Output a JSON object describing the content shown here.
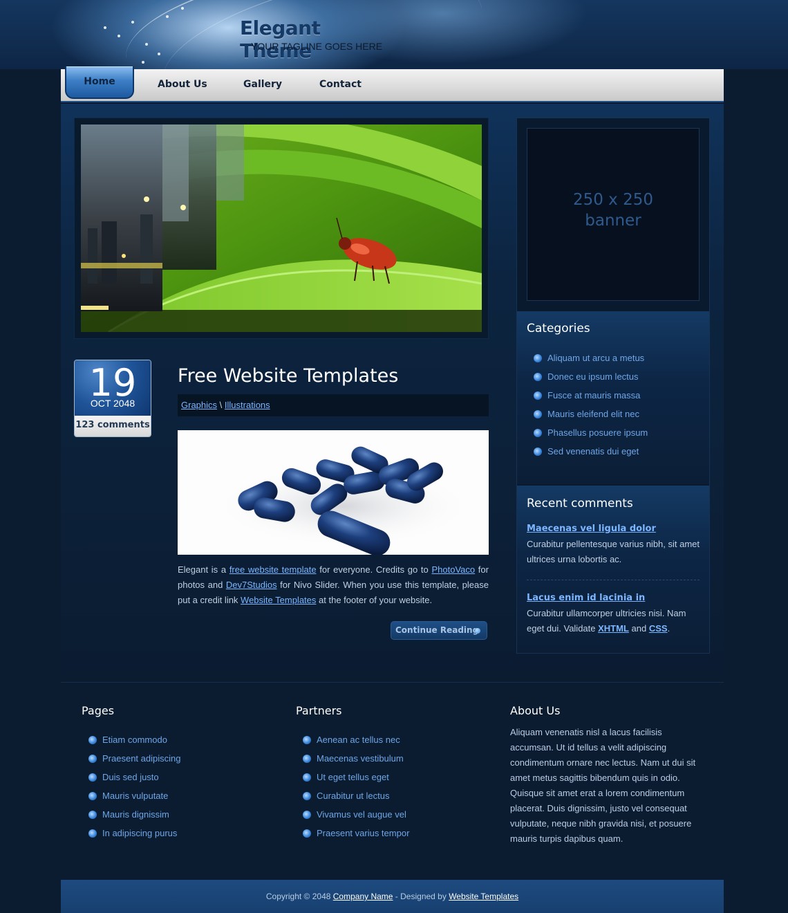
{
  "header": {
    "title": "Elegant Theme",
    "tagline": "YOUR TAGLINE GOES HERE"
  },
  "nav": {
    "items": [
      "Home",
      "About Us",
      "Gallery",
      "Contact"
    ],
    "active": "Home"
  },
  "slider": {
    "icon": "ladybug-on-leaf-image"
  },
  "post": {
    "day": "19",
    "month_year": "OCT 2048",
    "comments": "123 comments",
    "title": "Free Website Templates",
    "categories": [
      "Graphics",
      "Illustrations"
    ],
    "category_separator": "\\",
    "image_icon": "blue-pills-image",
    "body": {
      "t1": "Elegant is a ",
      "l1": "free website template",
      "t2": " for everyone. Credits go to ",
      "l2": "PhotoVaco",
      "t3": " for photos and ",
      "l3": "Dev7Studios",
      "t4": " for Nivo Slider. When you use this template, please put a credit link ",
      "l4": "Website Templates",
      "t5": " at the footer of your website."
    },
    "read_more": "Continue Reading"
  },
  "sidebar": {
    "banner_line1": "250 x 250",
    "banner_line2": "banner",
    "categories_title": "Categories",
    "categories": [
      "Aliquam ut arcu a metus",
      "Donec eu ipsum lectus",
      "Fusce at mauris massa",
      "Mauris eleifend elit nec",
      "Phasellus posuere ipsum",
      "Sed venenatis dui eget"
    ],
    "recent_title": "Recent comments",
    "comments": [
      {
        "link": "Maecenas vel ligula dolor",
        "text": "Curabitur pellentesque varius nibh, sit amet ultrices urna lobortis ac."
      },
      {
        "link": "Lacus enim id lacinia in",
        "text_before": "Curabitur ullamcorper ultricies nisi. Nam eget dui. Validate ",
        "xhtml": "XHTML",
        "and": " and ",
        "css": "CSS",
        "period": "."
      }
    ]
  },
  "footer": {
    "pages_title": "Pages",
    "pages": [
      "Etiam commodo",
      "Praesent adipiscing",
      "Duis sed justo",
      "Mauris vulputate",
      "Mauris dignissim",
      "In adipiscing purus"
    ],
    "partners_title": "Partners",
    "partners": [
      "Aenean ac tellus nec",
      "Maecenas vestibulum",
      "Ut eget tellus eget",
      "Curabitur ut lectus",
      "Vivamus vel augue vel",
      "Praesent varius tempor"
    ],
    "about_title": "About Us",
    "about_text": "Aliquam venenatis nisl a lacus facilisis accumsan. Ut id tellus a velit adipiscing condimentum ornare nec lectus. Nam ut dui sit amet metus sagittis bibendum quis in odio. Quisque sit amet erat a lorem condimentum placerat. Duis dignissim, justo vel consequat vulputate, neque nibh gravida nisi, et posuere mauris turpis dapibus quam.",
    "copyright": "Copyright © 2048 ",
    "company": "Company Name",
    "designed_by": " - Designed by ",
    "designer": "Website Templates"
  },
  "colors": {
    "background": "#0b1c31",
    "accent": "#1e4a80",
    "link": "#7cb6ff",
    "bullet": "#3a86dc"
  }
}
